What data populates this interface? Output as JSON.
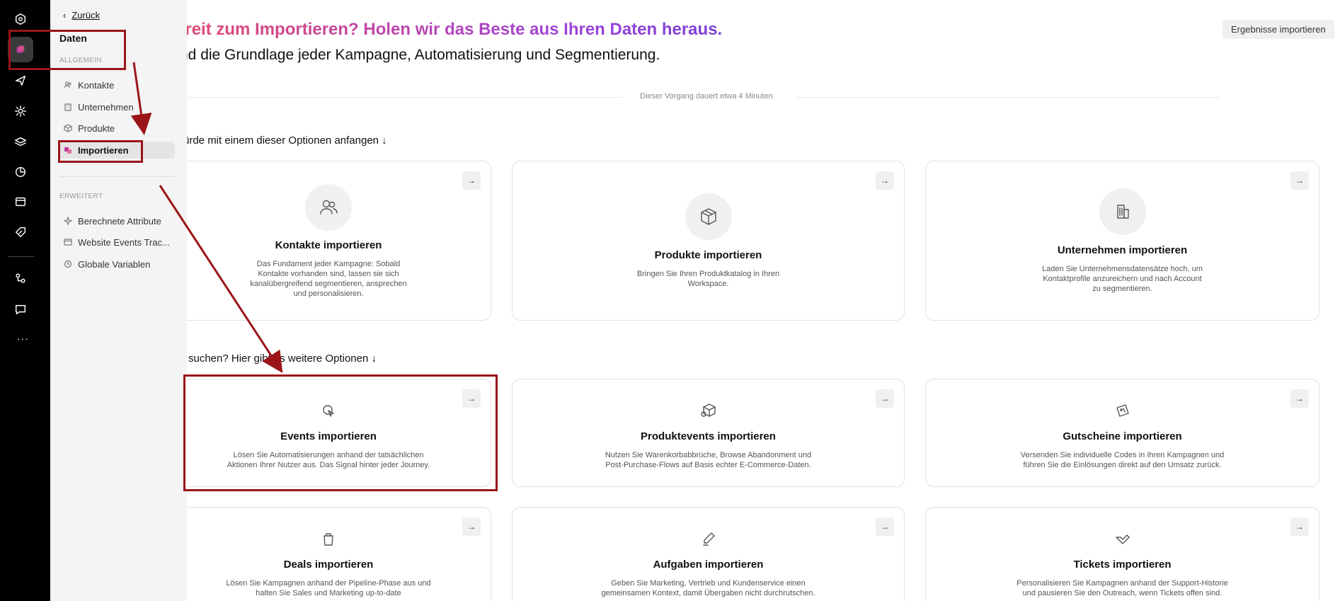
{
  "sidebar": {
    "back_label": "Zurück",
    "title": "Daten",
    "section_general": "ALLGEMEIN",
    "section_advanced": "ERWEITERT",
    "items_general": [
      "Kontakte",
      "Unternehmen",
      "Produkte",
      "Importieren"
    ],
    "items_advanced": [
      "Berechnete Attribute",
      "Website Events Trac...",
      "Globale Variablen"
    ],
    "active_item": "Importieren"
  },
  "header": {
    "headline": "ereit zum Importieren? Holen wir das Beste aus Ihren Daten heraus.",
    "subline": "nd die Grundlage jeder Kampagne, Automatisierung und Segmentierung.",
    "import_results_button": "Ergebnisse importieren",
    "duration_note": "Dieser Vorgang dauert etwa 4 Minuten"
  },
  "section_primary": {
    "lead": "ürde mit einem dieser Optionen anfangen ↓",
    "cards": [
      {
        "title": "Kontakte importieren",
        "icon": "users-icon",
        "desc": [
          "Das Fundament jeder Kampagne: Sobald",
          "Kontakte vorhanden sind, lassen sie sich",
          "kanalübergreifend segmentieren, ansprechen",
          "und personalisieren."
        ]
      },
      {
        "title": "Produkte importieren",
        "icon": "box-icon",
        "desc": [
          "Bringen Sie Ihren Produktkatalog in Ihren",
          "Workspace."
        ]
      },
      {
        "title": "Unternehmen importieren",
        "icon": "building-icon",
        "desc": [
          "Laden Sie Unternehmensdatensätze hoch, um",
          "Kontaktprofile anzureichern und nach Account",
          "zu segmentieren."
        ]
      }
    ]
  },
  "section_secondary": {
    "lead": "suchen? Hier gibt es weitere Optionen ↓",
    "cards": [
      {
        "title": "Events importieren",
        "icon": "pointer-icon",
        "desc": [
          "Lösen Sie Automatisierungen anhand der tatsächlichen",
          "Aktionen Ihrer Nutzer aus. Das Signal hinter jeder Journey."
        ]
      },
      {
        "title": "Produktevents importieren",
        "icon": "box-event-icon",
        "desc": [
          "Nutzen Sie Warenkorbabbrüche, Browse Abandonment und",
          "Post-Purchase-Flows auf Basis echter E-Commerce-Daten."
        ]
      },
      {
        "title": "Gutscheine importieren",
        "icon": "coupon-icon",
        "desc": [
          "Versenden Sie individuelle Codes in Ihren Kampagnen und",
          "führen Sie die Einlösungen direkt auf den Umsatz zurück."
        ]
      },
      {
        "title": "Deals importieren",
        "icon": "bag-icon",
        "desc": [
          "Lösen Sie Kampagnen anhand der Pipeline-Phase aus und",
          "halten Sie Sales und Marketing up-to-date"
        ]
      },
      {
        "title": "Aufgaben importieren",
        "icon": "pen-icon",
        "desc": [
          "Geben Sie Marketing, Vertrieb und Kundenservice einen",
          "gemeinsamen Kontext, damit Übergaben nicht durchrutschen."
        ]
      },
      {
        "title": "Tickets importieren",
        "icon": "ticket-check-icon",
        "desc": [
          "Personalisieren Sie Kampagnen anhand der Support-Historie",
          "und pausieren Sie den Outreach, wenn Tickets offen sind."
        ]
      }
    ]
  },
  "colors": {
    "highlight": "#9b1518",
    "rail": "#000000",
    "sidebar": "#f4f4f4"
  }
}
